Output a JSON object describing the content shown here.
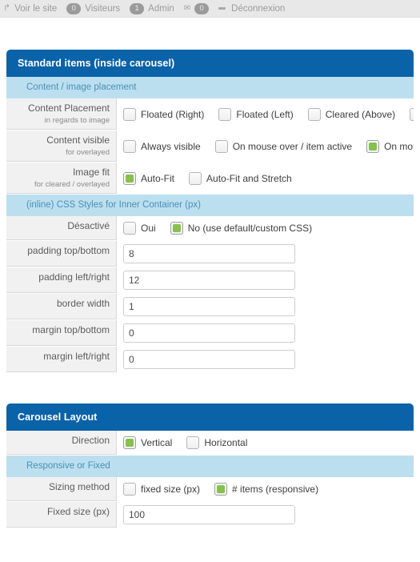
{
  "adminbar": {
    "items": [
      {
        "icon": "external-link-icon",
        "label": "Voir le site",
        "badge": null
      },
      {
        "icon": null,
        "label": "Visiteurs",
        "badge": "0"
      },
      {
        "icon": null,
        "label": "Admin",
        "badge": "1"
      },
      {
        "icon": "mail-icon",
        "label": "",
        "badge": "0"
      },
      {
        "icon": "dash-icon",
        "label": "Déconnexion",
        "badge": null
      }
    ]
  },
  "panels": [
    {
      "title": "Standard items (inside carousel)",
      "blocks": [
        {
          "type": "section",
          "title": "Content / image placement"
        },
        {
          "type": "row",
          "label": "Content Placement",
          "sublabel": "in regards to image",
          "field": {
            "kind": "checkboxes",
            "options": [
              {
                "label": "Floated (Right)",
                "checked": false
              },
              {
                "label": "Floated (Left)",
                "checked": false
              },
              {
                "label": "Cleared (Above)",
                "checked": false
              },
              {
                "label": "",
                "checked": false
              }
            ]
          }
        },
        {
          "type": "row",
          "label": "Content visible",
          "sublabel": "for overlayed",
          "field": {
            "kind": "checkboxes",
            "options": [
              {
                "label": "Always visible",
                "checked": false
              },
              {
                "label": "On mouse over / item active",
                "checked": false
              },
              {
                "label": "On mous",
                "checked": true
              }
            ]
          }
        },
        {
          "type": "row",
          "label": "Image fit",
          "sublabel": "for cleared / overlayed",
          "field": {
            "kind": "checkboxes",
            "options": [
              {
                "label": "Auto-Fit",
                "checked": true
              },
              {
                "label": "Auto-Fit and Stretch",
                "checked": false
              }
            ]
          }
        },
        {
          "type": "section",
          "title": "(inline) CSS Styles for Inner Container (px)"
        },
        {
          "type": "row",
          "label": "Désactivé",
          "sublabel": "",
          "field": {
            "kind": "checkboxes",
            "options": [
              {
                "label": "Oui",
                "checked": false
              },
              {
                "label": "No (use default/custom CSS)",
                "checked": true
              }
            ]
          }
        },
        {
          "type": "row",
          "label": "padding top/bottom",
          "sublabel": "",
          "field": {
            "kind": "text",
            "value": "8"
          }
        },
        {
          "type": "row",
          "label": "padding left/right",
          "sublabel": "",
          "field": {
            "kind": "text",
            "value": "12"
          }
        },
        {
          "type": "row",
          "label": "border width",
          "sublabel": "",
          "field": {
            "kind": "text",
            "value": "1"
          }
        },
        {
          "type": "row",
          "label": "margin top/bottom",
          "sublabel": "",
          "field": {
            "kind": "text",
            "value": "0"
          }
        },
        {
          "type": "row",
          "label": "margin left/right",
          "sublabel": "",
          "field": {
            "kind": "text",
            "value": "0"
          }
        }
      ]
    },
    {
      "title": "Carousel Layout",
      "blocks": [
        {
          "type": "row",
          "label": "Direction",
          "sublabel": "",
          "field": {
            "kind": "checkboxes",
            "options": [
              {
                "label": "Vertical",
                "checked": true
              },
              {
                "label": "Horizontal",
                "checked": false
              }
            ]
          }
        },
        {
          "type": "section",
          "title": "Responsive or Fixed"
        },
        {
          "type": "row",
          "label": "Sizing method",
          "sublabel": "",
          "field": {
            "kind": "checkboxes",
            "options": [
              {
                "label": "fixed size (px)",
                "checked": false
              },
              {
                "label": "# items (responsive)",
                "checked": true
              }
            ]
          }
        },
        {
          "type": "row",
          "label": "Fixed size (px)",
          "sublabel": "",
          "field": {
            "kind": "text",
            "value": "100"
          }
        }
      ]
    }
  ],
  "colors": {
    "panel_header_bg": "#0a62a8",
    "section_header_bg": "#bcdff0",
    "section_header_text": "#4a8fb5",
    "checked_green": "#84c24a",
    "label_bg": "#f1f1f1",
    "adminbar_bg": "#e8e8e8"
  }
}
